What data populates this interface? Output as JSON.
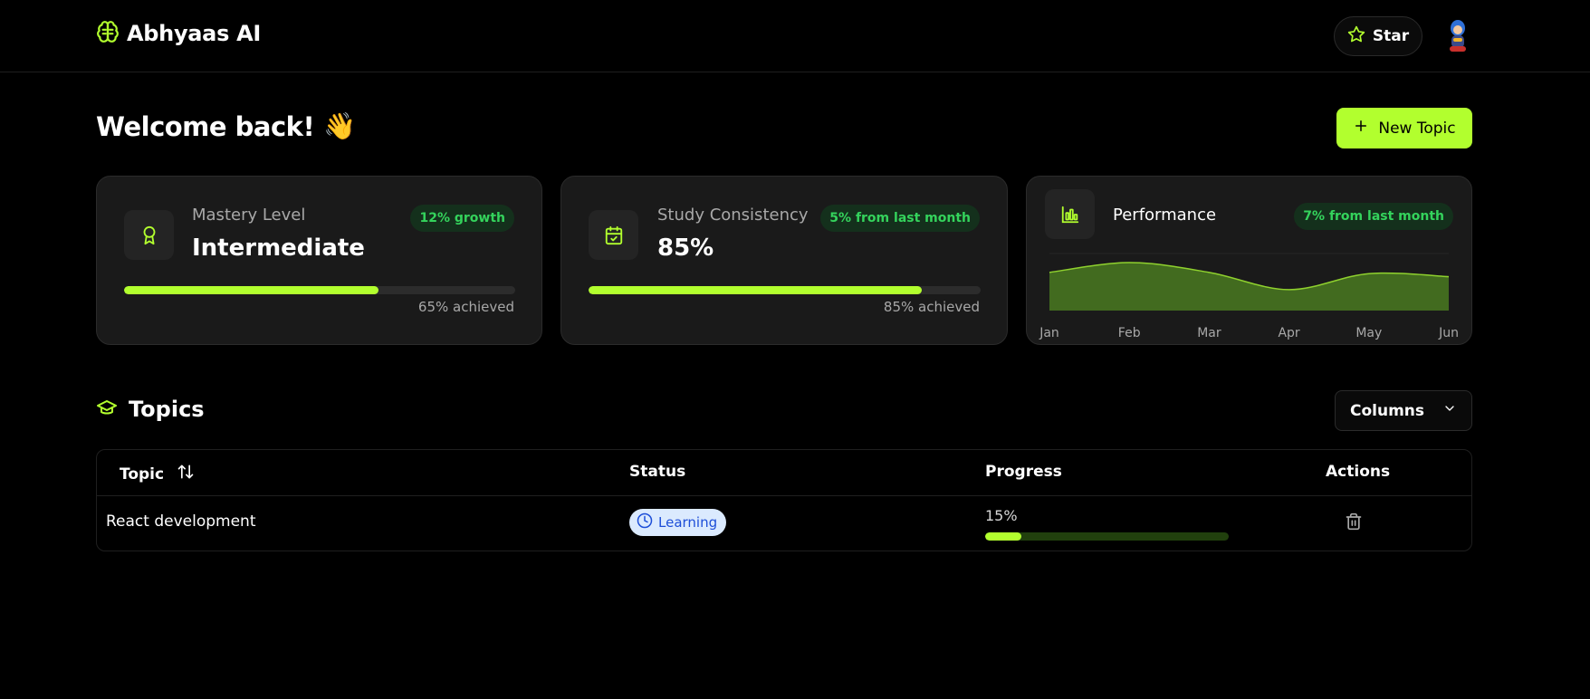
{
  "header": {
    "brand_name": "Abhyaas AI",
    "brand_icon": "brain-icon",
    "star_label": "Star"
  },
  "welcome": {
    "title": "Welcome back!",
    "emoji": "👋",
    "new_topic_label": "New Topic"
  },
  "cards": {
    "mastery": {
      "title": "Mastery Level",
      "value": "Intermediate",
      "badge": "12% growth",
      "progress": 0.65,
      "caption": "65% achieved",
      "icon": "award-icon"
    },
    "consistency": {
      "title": "Study Consistency",
      "value": "85%",
      "badge": "5% from last month",
      "progress": 0.85,
      "caption": "85% achieved",
      "icon": "calendar-check-icon"
    },
    "performance": {
      "title": "Performance",
      "badge": "7% from last month",
      "icon": "bar-chart-icon"
    }
  },
  "chart_data": {
    "type": "area",
    "x": [
      "Jan",
      "Feb",
      "Mar",
      "Apr",
      "May",
      "Jun"
    ],
    "series": [
      {
        "values": [
          62,
          78,
          62,
          34,
          60,
          55
        ]
      }
    ],
    "ylim": [
      0,
      100
    ],
    "xlabel": "",
    "ylabel": "",
    "title": "",
    "grid": false
  },
  "topics": {
    "title": "Topics",
    "columns_label": "Columns",
    "headers": {
      "topic": "Topic",
      "status": "Status",
      "progress": "Progress",
      "actions": "Actions"
    },
    "rows": [
      {
        "topic": "React development",
        "status": "Learning",
        "progress_label": "15%",
        "progress": 0.15
      }
    ]
  },
  "colors": {
    "accent": "#b2ff2e",
    "badge_text": "#34d35c",
    "status_bg": "#dbeafe",
    "status_text": "#1d4ed8"
  }
}
